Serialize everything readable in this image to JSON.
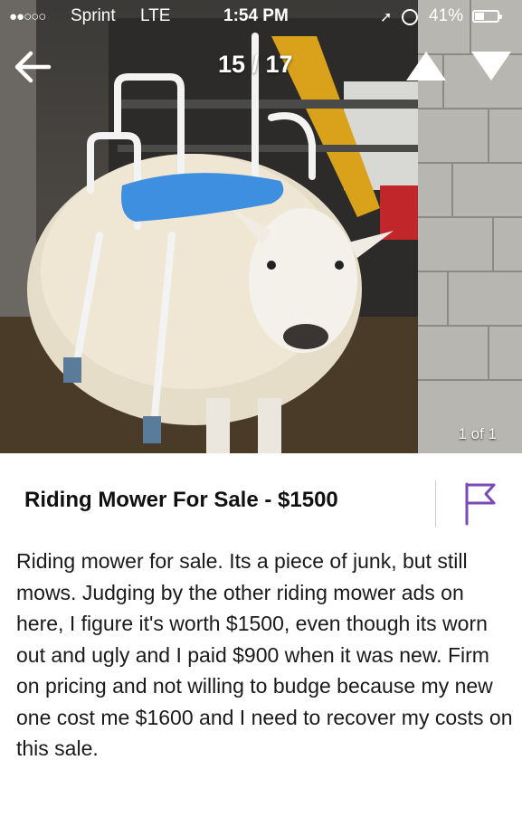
{
  "status_bar": {
    "signal": "●●○○○",
    "carrier": "Sprint",
    "network": "LTE",
    "time": "1:54 PM",
    "battery": "41%"
  },
  "nav": {
    "counter": "15 / 17",
    "back_icon": "arrow-left-icon",
    "prev_icon": "triangle-up-icon",
    "next_icon": "triangle-down-icon"
  },
  "photo": {
    "count": "1 of 1"
  },
  "listing": {
    "title": "Riding Mower For Sale - $1500",
    "description": "Riding mower for sale. Its a piece of junk, but still mows. Judging by the other riding mower ads on here, I figure it's worth $1500, even though its worn out and ugly and I paid $900 when it was new. Firm on pricing and not willing to budge because my new one cost me $1600 and I need to recover my costs on this sale.",
    "flag_icon": "flag-icon"
  },
  "colors": {
    "flag": "#7b4bb5",
    "seat": "#3f8fe0"
  }
}
